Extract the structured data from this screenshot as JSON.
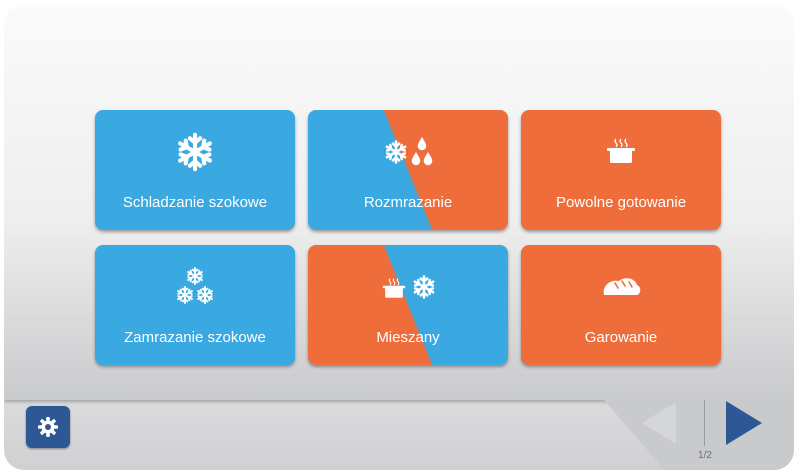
{
  "modes": [
    {
      "label": "Schladzanie szokowe",
      "icon": "snowflake-icon"
    },
    {
      "label": "Rozmrazanie",
      "icon": "snowflake-droplets-icon"
    },
    {
      "label": "Powolne gotowanie",
      "icon": "steaming-pot-icon"
    },
    {
      "label": "Zamrazanie szokowe",
      "icon": "three-snowflakes-icon"
    },
    {
      "label": "Mieszany",
      "icon": "pot-snowflake-icon"
    },
    {
      "label": "Garowanie",
      "icon": "bread-icon"
    }
  ],
  "navigation": {
    "page_indicator": "1/2",
    "settings_icon": "gear-icon",
    "prev_icon": "triangle-left-icon",
    "next_icon": "triangle-right-icon"
  },
  "colors": {
    "blue": "#3aa9e1",
    "orange": "#ef6d3b",
    "settings_button": "#2e5796",
    "prev_arrow_disabled": "#d5d6d8",
    "next_arrow": "#2e5796"
  }
}
